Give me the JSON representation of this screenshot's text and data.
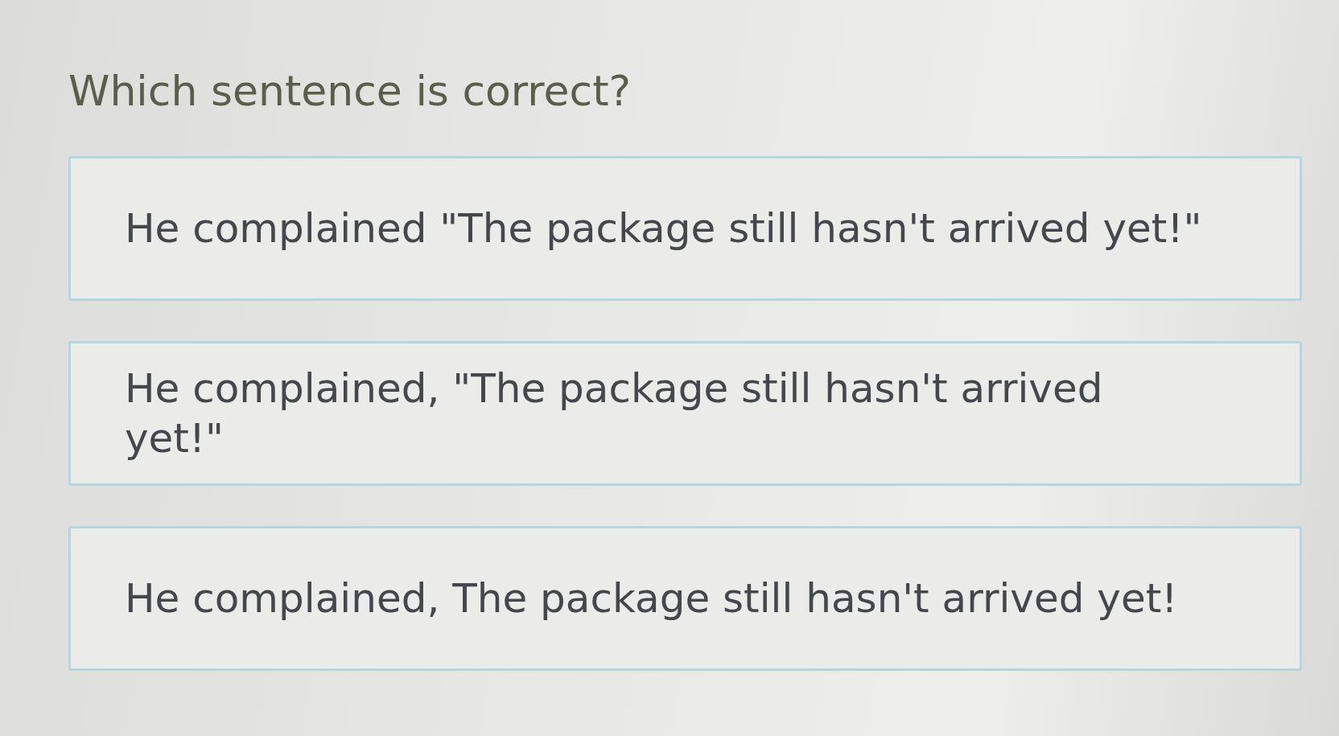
{
  "question": "Which sentence is correct?",
  "options": [
    {
      "text": "He complained \"The package still hasn't arrived yet!\"",
      "selected": false
    },
    {
      "text": "He complained, \"The package still hasn't arrived yet!\"",
      "selected": false
    },
    {
      "text": "He complained, The package still hasn't arrived yet!",
      "selected": false
    }
  ]
}
